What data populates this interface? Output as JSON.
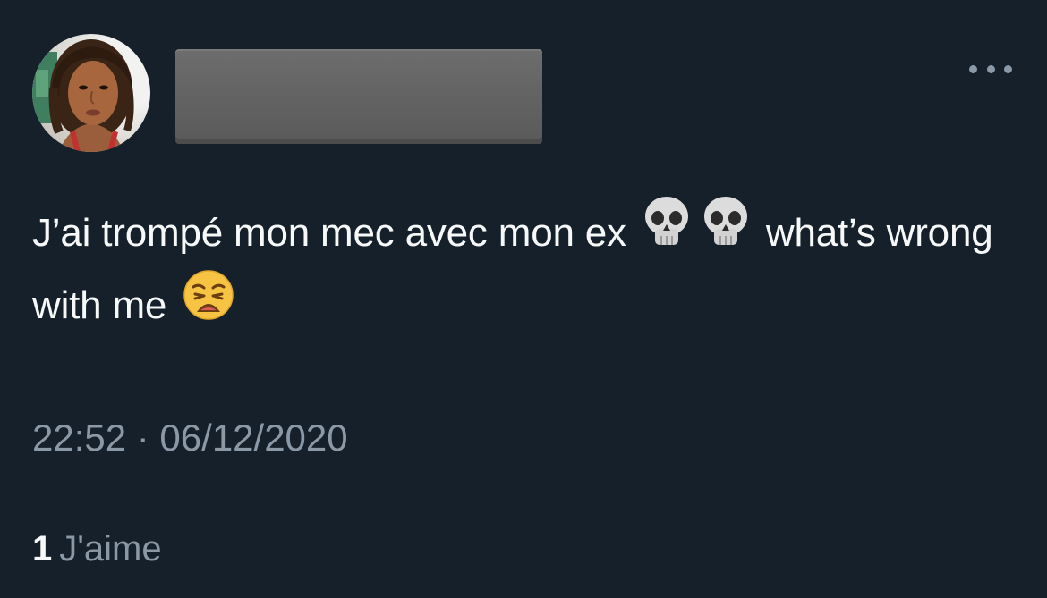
{
  "author": {
    "avatar_icon": "profile-photo",
    "name_redacted": true
  },
  "menu": {
    "icon": "more-options-icon"
  },
  "tweet": {
    "text_part1": "J’ai trompé mon mec avec mon ex",
    "emoji1": "skull",
    "emoji2": "skull",
    "text_part2": "what’s wrong with me",
    "emoji3": "weary-face",
    "timestamp": "22:52 · 06/12/2020"
  },
  "engagement": {
    "likes_count": "1",
    "likes_label": "J'aime"
  },
  "colors": {
    "background": "#15202b",
    "text": "#f7f9f9",
    "secondary_text": "#8b98a5",
    "divider": "#38444d",
    "redaction": "#646464"
  }
}
